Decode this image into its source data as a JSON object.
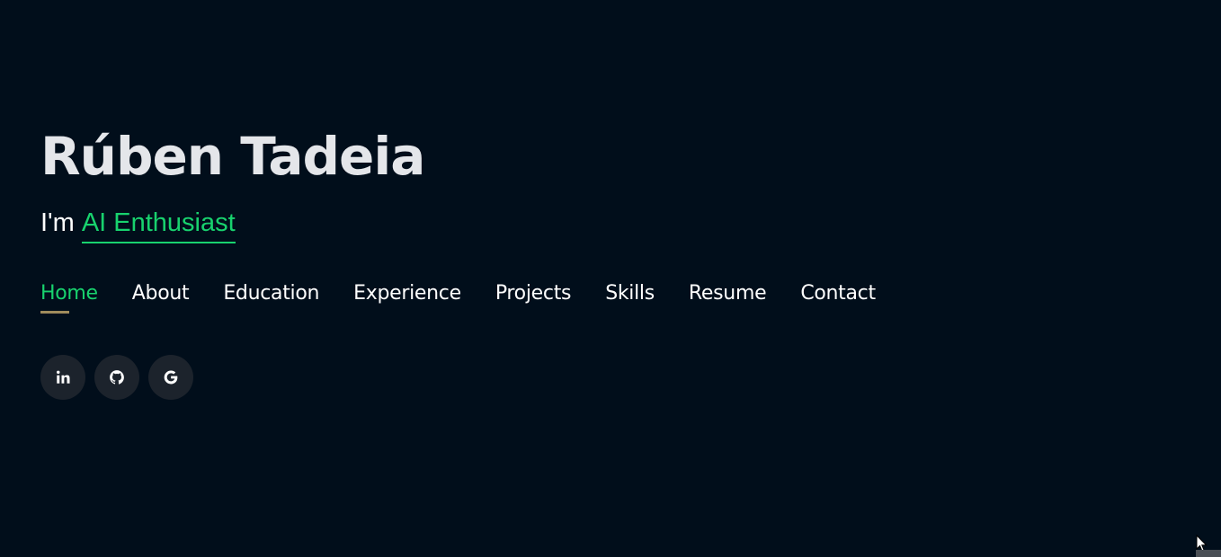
{
  "hero": {
    "name": "Rúben Tadeia",
    "tagline_prefix": "I'm ",
    "tagline_role": "AI Enthusiast"
  },
  "nav": {
    "items": [
      {
        "label": "Home",
        "active": true
      },
      {
        "label": "About"
      },
      {
        "label": "Education"
      },
      {
        "label": "Experience"
      },
      {
        "label": "Projects"
      },
      {
        "label": "Skills"
      },
      {
        "label": "Resume"
      },
      {
        "label": "Contact"
      }
    ]
  },
  "social": {
    "links": [
      {
        "icon": "linkedin-icon"
      },
      {
        "icon": "github-icon"
      },
      {
        "icon": "google-icon"
      }
    ]
  },
  "colors": {
    "background": "#010e1b",
    "accent": "#18d26e",
    "name_text": "#e4e6ea",
    "nav_text": "#ffffff",
    "active_underline": "#a08b5c",
    "social_bg": "#1c232c"
  }
}
